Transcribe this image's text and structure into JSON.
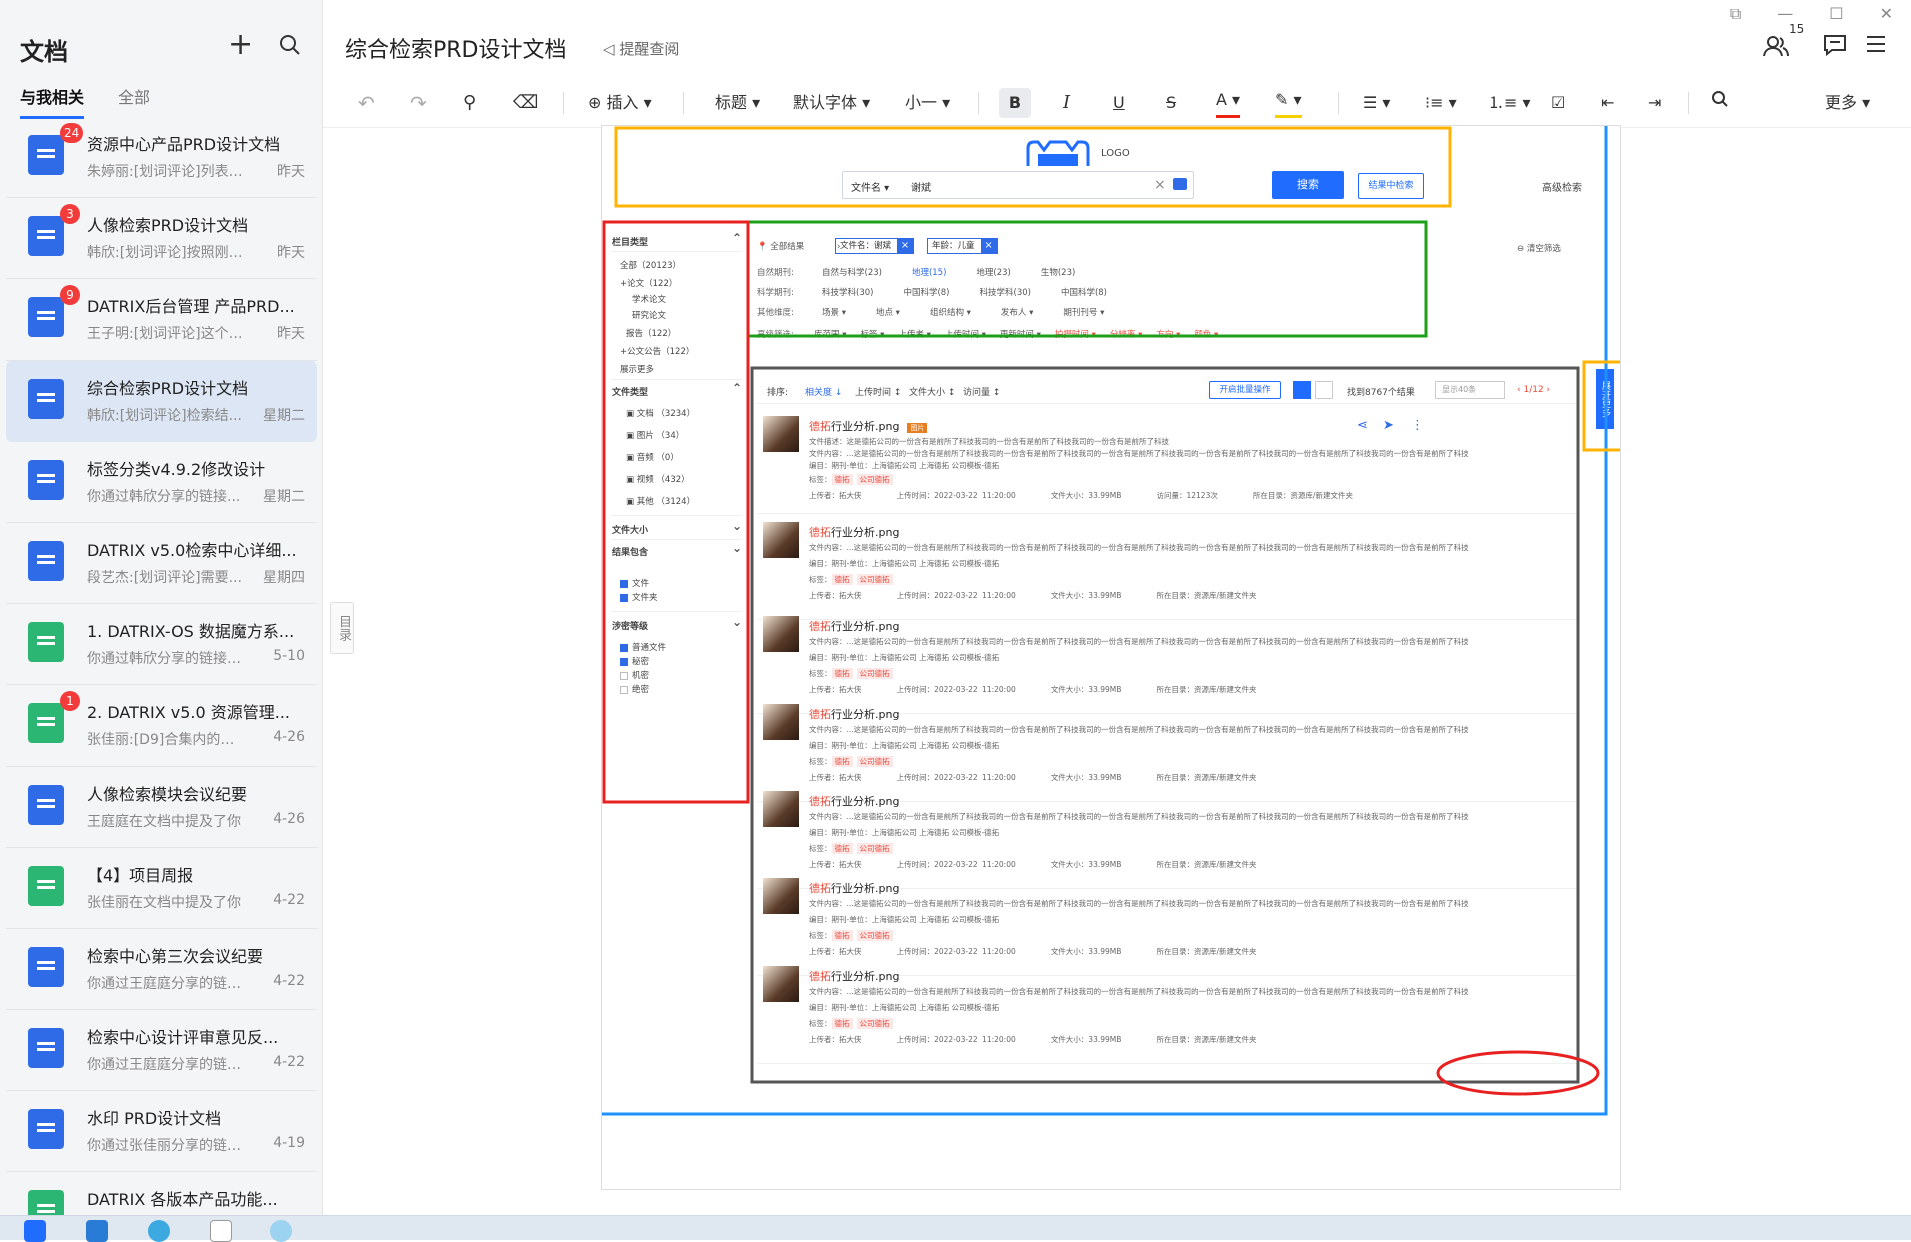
{
  "sidebar": {
    "title": "文档",
    "tabs": [
      "与我相关",
      "全部"
    ],
    "docs": [
      {
        "title": "资源中心产品PRD设计文档",
        "sub": "朱婷丽:[划词评论]列表模...",
        "date": "昨天",
        "badge": "24",
        "color": "blue"
      },
      {
        "title": "人像检索PRD设计文档",
        "sub": "韩欣:[划词评论]按照刚刚...",
        "date": "昨天",
        "badge": "3",
        "color": "blue"
      },
      {
        "title": "DATRIX后台管理 产品PRD...",
        "sub": "王子明:[划词评论]这个编...",
        "date": "昨天",
        "badge": "9",
        "color": "blue"
      },
      {
        "title": "综合检索PRD设计文档",
        "sub": "韩欣:[划词评论]检索结...",
        "date": "星期二",
        "badge": "",
        "color": "blue",
        "active": true
      },
      {
        "title": "标签分类v4.9.2修改设计",
        "sub": "你通过韩欣分享的链接...",
        "date": "星期二",
        "badge": "",
        "color": "blue"
      },
      {
        "title": "DATRIX v5.0检索中心详细...",
        "sub": "段艺杰:[划词评论]需要...",
        "date": "星期四",
        "badge": "",
        "color": "blue"
      },
      {
        "title": "1. DATRIX-OS 数据魔方系...",
        "sub": "你通过韩欣分享的链接加...",
        "date": "5-10",
        "badge": "",
        "color": "green"
      },
      {
        "title": "2. DATRIX v5.0 资源管理...",
        "sub": "张佳丽:[D9]合集内的文件...",
        "date": "4-26",
        "badge": "1",
        "color": "green"
      },
      {
        "title": "人像检索模块会议纪要",
        "sub": "王庭庭在文档中提及了你",
        "date": "4-26",
        "badge": "",
        "color": "blue"
      },
      {
        "title": "【4】项目周报",
        "sub": "张佳丽在文档中提及了你",
        "date": "4-22",
        "badge": "",
        "color": "green"
      },
      {
        "title": "检索中心第三次会议纪要",
        "sub": "你通过王庭庭分享的链接...",
        "date": "4-22",
        "badge": "",
        "color": "blue"
      },
      {
        "title": "检索中心设计评审意见反...",
        "sub": "你通过王庭庭分享的链接...",
        "date": "4-22",
        "badge": "",
        "color": "blue"
      },
      {
        "title": "水印 PRD设计文档",
        "sub": "你通过张佳丽分享的链接...",
        "date": "4-19",
        "badge": "",
        "color": "blue"
      },
      {
        "title": "DATRIX 各版本产品功能...",
        "sub": "",
        "date": "",
        "badge": "",
        "color": "green"
      }
    ]
  },
  "header": {
    "title": "综合检索PRD设计文档",
    "remind": "提醒查阅",
    "users_count": "15"
  },
  "toolbar": {
    "insert": "插入",
    "heading": "标题",
    "font": "默认字体",
    "size": "小一",
    "more": "更多"
  },
  "toc": "目录",
  "mock": {
    "logo": "LOGO",
    "search_field": "文件名",
    "search_value": "谢斌",
    "search_btn": "搜索",
    "in_result_btn": "结果中检索",
    "advanced": "高级检索",
    "filters": {
      "column_type": "栏目类型",
      "all": "全部（20123）",
      "paper": "+论文（122）",
      "paper_sub1": "学术论文",
      "paper_sub2": "研究论文",
      "report": "报告（122）",
      "announce": "+公文公告（122）",
      "show_more": "展示更多",
      "file_type": "文件类型",
      "ft1": "文档 （3234）",
      "ft2": "图片 （34）",
      "ft3": "音频 （0）",
      "ft4": "视频 （432）",
      "ft5": "其他 （3124）",
      "file_size": "文件大小",
      "result_contains": "结果包含",
      "rc1": "文件",
      "rc2": "文件夹",
      "secret_level": "涉密等级",
      "sl1": "普通文件",
      "sl2": "秘密",
      "sl3": "机密",
      "sl4": "绝密"
    },
    "chips": {
      "all_results": "全部结果",
      "chip1": "文件名：谢斌",
      "chip2": "年龄：儿童",
      "clear": "清空筛选",
      "row1_label": "自然期刊:",
      "row1": [
        "自然与科学(23)",
        "地理(15)",
        "地理(23)",
        "生物(23)"
      ],
      "row2_label": "科学期刊:",
      "row2": [
        "科技学科(30)",
        "中国科学(8)",
        "科技学科(30)",
        "中国科学(8)"
      ],
      "row3_label": "其他维度:",
      "row3": [
        "场景 ▾",
        "地点 ▾",
        "组织结构 ▾",
        "发布人 ▾",
        "期刊刊号 ▾"
      ],
      "row4_label": "高级筛选:",
      "row4": [
        "库范围 ▾",
        "标签 ▾",
        "上传者 ▾",
        "上传时间 ▾",
        "更新时间 ▾",
        "拍摄时间 ▾",
        "分辨率 ▾",
        "方向 ▾",
        "颜色 ▾"
      ]
    },
    "sort": {
      "label": "排序:",
      "relevance": "相关度 ↓",
      "upload": "上传时间 ↕",
      "size": "文件大小 ↕",
      "views": "访问量 ↕",
      "batch": "开启批量操作",
      "found": "找到8767个结果",
      "per_page": "显示40条",
      "page": "1/12"
    },
    "expand": "展开更多",
    "result": {
      "title_hl": "德拓",
      "title_rest": "行业分析.png",
      "tag": "图片",
      "desc": "文件描述：这是德拓公司的一份含有是前所了科技我司的一份含有是前所了科技我司的一份含有是前所了科技",
      "content": "文件内容：...这是德拓公司的一份含有是前所了科技我司的一份含有是前所了科技我司的一份含有是前所了科技我司的一份含有是前所了科技我司的一份含有是前所了科技我司的一份含有是前所了科技",
      "catalog": "编目：期刊-单位：上海德拓公司    上海德拓    公司模板-德拓",
      "tags_label": "标签：",
      "tag1": "德拓",
      "tag2": "公司德拓",
      "uploader": "上传者：拓大侠",
      "time": "上传时间：2022-03-22 11:20:00",
      "fsize": "文件大小：33.99MB",
      "visits": "访问量：12123次",
      "folder": "所在目录：资源库/新建文件夹"
    }
  },
  "colors": {
    "accent": "#1f6cff",
    "annot_blue": "#1e90ff",
    "annot_orange": "#ffb300",
    "annot_green": "#1aa01a",
    "annot_red": "#e82020"
  }
}
